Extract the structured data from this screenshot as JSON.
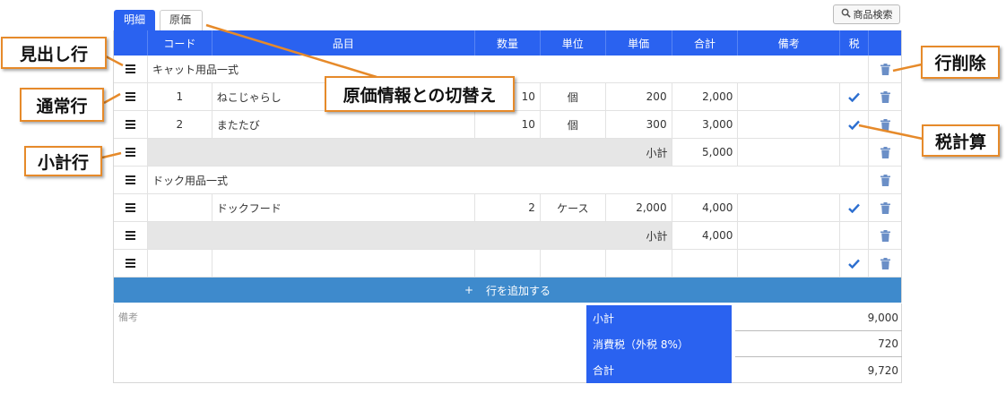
{
  "tabs": {
    "detail": "明細",
    "cost": "原価"
  },
  "search_button": {
    "label": "商品検索",
    "icon": "search-icon"
  },
  "columns": [
    "コード",
    "品目",
    "数量",
    "単位",
    "単価",
    "合計",
    "備考",
    "税"
  ],
  "rows": {
    "cat_heading": {
      "title": "キャット用品一式"
    },
    "cat_1": {
      "code": "1",
      "name": "ねこじゃらし",
      "qty": "10",
      "unit": "個",
      "price": "200",
      "total": "2,000"
    },
    "cat_2": {
      "code": "2",
      "name": "またたび",
      "qty": "10",
      "unit": "個",
      "price": "300",
      "total": "3,000"
    },
    "cat_subtotal": {
      "label": "小計",
      "total": "5,000"
    },
    "dog_heading": {
      "title": "ドック用品一式"
    },
    "dog_1": {
      "code": "",
      "name": "ドックフード",
      "qty": "2",
      "unit": "ケース",
      "price": "2,000",
      "total": "4,000"
    },
    "dog_subtotal": {
      "label": "小計",
      "total": "4,000"
    }
  },
  "add_row": {
    "icon": "+",
    "label": "行を追加する"
  },
  "memo": {
    "label": "備考"
  },
  "summary": {
    "subtotal_label": "小計",
    "subtotal_value": "9,000",
    "tax_label": "消費税（外税 8%）",
    "tax_value": "720",
    "total_label": "合計",
    "total_value": "9,720"
  },
  "callouts": {
    "heading_row": "見出し行",
    "normal_row": "通常行",
    "subtotal_row": "小計行",
    "cost_toggle": "原価情報との切替え",
    "delete_row": "行削除",
    "tax_calc": "税計算"
  },
  "colors": {
    "accent": "#2a62f0",
    "add_bar": "#3e8acc",
    "callout_border": "#e68a2a",
    "check": "#2d6fd0",
    "trash": "#6b8fc7"
  }
}
